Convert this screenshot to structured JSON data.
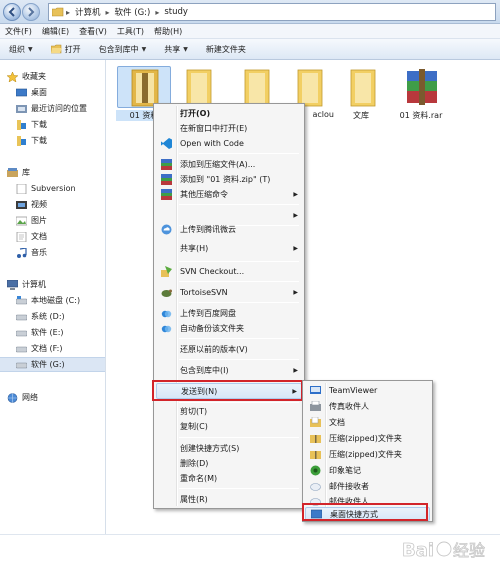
{
  "address_bar": {
    "breadcrumbs": [
      "计算机",
      "软件 (G:)",
      "study"
    ]
  },
  "menu_bar": {
    "items": [
      "文件(F)",
      "编辑(E)",
      "查看(V)",
      "工具(T)",
      "帮助(H)"
    ]
  },
  "toolbar": {
    "organize": "组织",
    "open": "打开",
    "include_in_library": "包含到库中",
    "share": "共享",
    "new_folder": "新建文件夹"
  },
  "nav_pane": {
    "favorites": "收藏夹",
    "favorites_items": [
      "桌面",
      "最近访问的位置",
      "下载",
      "下载"
    ],
    "libraries": "库",
    "library_items": [
      "Subversion",
      "视频",
      "图片",
      "文档",
      "音乐"
    ],
    "computer": "计算机",
    "drives": [
      "本地磁盘 (C:)",
      "系统 (D:)",
      "软件 (E:)",
      "文档 (F:)",
      "软件 (G:)"
    ],
    "network": "网络"
  },
  "files": [
    {
      "name": "01 资料",
      "icon": "folder-icon"
    },
    {
      "name": "",
      "icon": "folder-icon"
    },
    {
      "name": "",
      "icon": "folder-icon"
    },
    {
      "name": "aclou",
      "icon": "folder-icon"
    },
    {
      "name": "文库",
      "icon": "folder-icon"
    },
    {
      "name": "01 资料.rar",
      "icon": "rar-archive-icon"
    }
  ],
  "context_menu": {
    "open": "打开(O)",
    "open_new_window": "在新窗口中打开(E)",
    "open_with_code": "Open with Code",
    "add_to_archive": "添加到压缩文件(A)...",
    "add_to_zip": "添加到 \"01 资料.zip\" (T)",
    "other_compress": "其他压缩命令",
    "upload_weiyun": "上传到腾讯微云",
    "share": "共享(H)",
    "svn_checkout": "SVN Checkout...",
    "tortoise_svn": "TortoiseSVN",
    "upload_baidu": "上传到百度网盘",
    "auto_backup": "自动备份该文件夹",
    "restore_previous": "还原以前的版本(V)",
    "include_in_library": "包含到库中(I)",
    "send_to": "发送到(N)",
    "cut": "剪切(T)",
    "copy": "复制(C)",
    "create_shortcut": "创建快捷方式(S)",
    "delete": "删除(D)",
    "rename": "重命名(M)",
    "properties": "属性(R)"
  },
  "send_to_menu": {
    "teamviewer": "TeamViewer",
    "fax_recipient": "传真收件人",
    "documents": "文档",
    "zip_folder_1": "压缩(zipped)文件夹",
    "zip_folder_2": "压缩(zipped)文件夹",
    "evernote": "印象笔记",
    "mail_recipient_1": "邮件接收者",
    "mail_recipient_2": "邮件收件人",
    "desktop_shortcut": "桌面快捷方式"
  },
  "colors": {
    "highlight_box": "#d2242a",
    "selection": "#cde3f9",
    "folder_yellow": "#f2cf63"
  }
}
